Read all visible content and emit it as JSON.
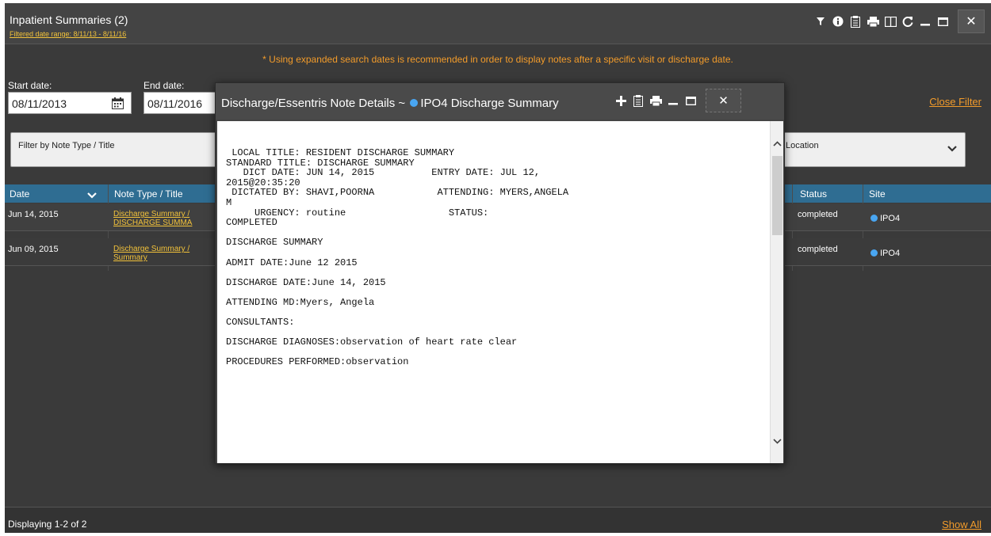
{
  "header": {
    "title": "Inpatient Summaries (2)",
    "filtered_range": "Filtered date range: 8/11/13 - 8/11/16"
  },
  "notice": "* Using expanded search dates is recommended in order to display notes after a specific visit or discharge date.",
  "filter": {
    "start_label": "Start date:",
    "start_value": "08/11/2013",
    "end_label": "End date:",
    "end_value": "08/11/2016",
    "close_filter": "Close Filter",
    "note_type_placeholder": "Filter by Note Type / Title",
    "location_placeholder": "Location"
  },
  "grid": {
    "columns": {
      "date": "Date",
      "note_type": "Note Type / Title",
      "status": "Status",
      "site": "Site"
    },
    "rows": [
      {
        "date": "Jun 14, 2015",
        "note_line1": "Discharge Summary /",
        "note_line2": "DISCHARGE SUMMA",
        "status": "completed",
        "site": "IPO4"
      },
      {
        "date": "Jun 09, 2015",
        "note_line1": "Discharge Summary /",
        "note_line2": "Summary",
        "status": "completed",
        "site": "IPO4"
      }
    ]
  },
  "footer": {
    "displaying": "Displaying 1-2 of 2",
    "show_all": "Show All"
  },
  "modal": {
    "title_prefix": "Discharge/Essentris Note Details ~",
    "title_site": "IPO4 Discharge Summary",
    "note_text": " LOCAL TITLE: RESIDENT DISCHARGE SUMMARY\nSTANDARD TITLE: DISCHARGE SUMMARY\n   DICT DATE: JUN 14, 2015          ENTRY DATE: JUL 12,\n2015@20:35:20\n DICTATED BY: SHAVI,POORNA           ATTENDING: MYERS,ANGELA\nM\n     URGENCY: routine                  STATUS:\nCOMPLETED\n\nDISCHARGE SUMMARY\n\nADMIT DATE:June 12 2015\n\nDISCHARGE DATE:June 14, 2015\n\nATTENDING MD:Myers, Angela\n\nCONSULTANTS:\n\nDISCHARGE DIAGNOSES:observation of heart rate clear\n\nPROCEDURES PERFORMED:observation"
  },
  "colors": {
    "accent_yellow": "#f2c23a",
    "accent_orange": "#f29b2a",
    "grid_header": "#2f6d92",
    "site_dot": "#49a6f2"
  },
  "icons": [
    "filter-icon",
    "info-icon",
    "clipboard-icon",
    "print-icon",
    "columns-icon",
    "refresh-icon",
    "minimize-icon",
    "maximize-icon",
    "close-icon",
    "calendar-icon",
    "chevron-down-icon",
    "plus-icon"
  ]
}
